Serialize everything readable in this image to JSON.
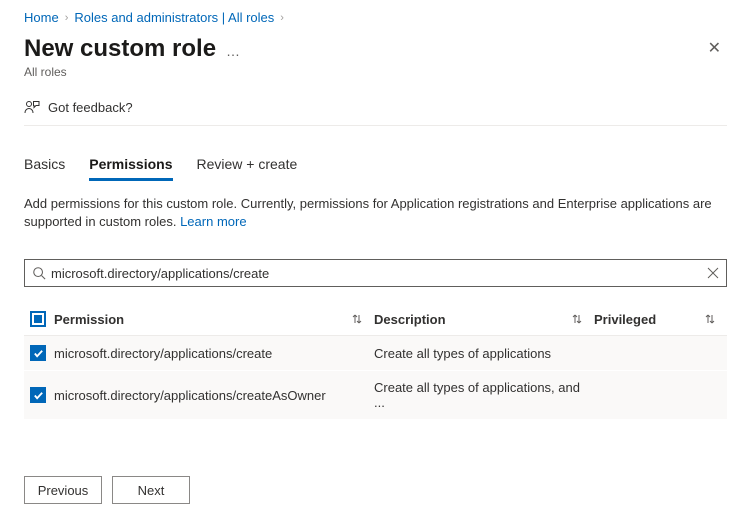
{
  "breadcrumb": {
    "home": "Home",
    "roles": "Roles and administrators | All roles"
  },
  "title": "New custom role",
  "subtitle": "All roles",
  "feedback": "Got feedback?",
  "tabs": {
    "basics": "Basics",
    "permissions": "Permissions",
    "review": "Review + create"
  },
  "description_text": "Add permissions for this custom role. Currently, permissions for Application registrations and Enterprise applications are supported in custom roles. ",
  "learn_more": "Learn more",
  "search": {
    "value": "microsoft.directory/applications/create"
  },
  "columns": {
    "permission": "Permission",
    "description": "Description",
    "privileged": "Privileged"
  },
  "rows": [
    {
      "permission": "microsoft.directory/applications/create",
      "description": "Create all types of applications"
    },
    {
      "permission": "microsoft.directory/applications/createAsOwner",
      "description": "Create all types of applications, and ..."
    }
  ],
  "buttons": {
    "previous": "Previous",
    "next": "Next"
  }
}
